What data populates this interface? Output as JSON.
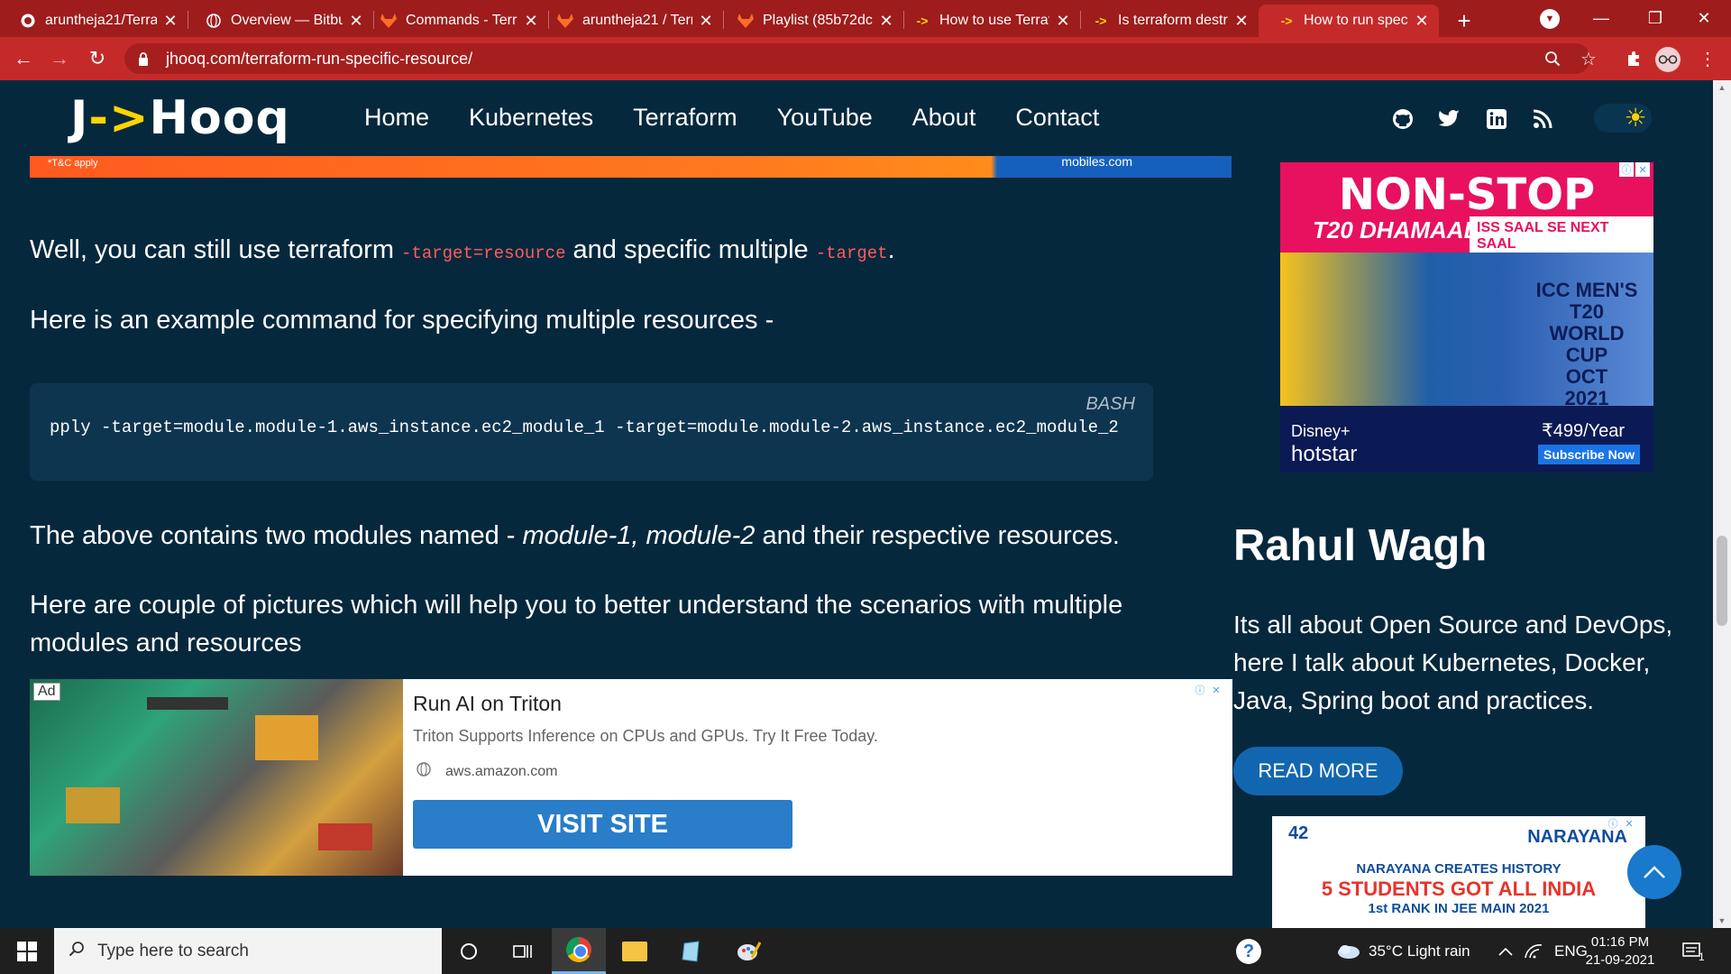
{
  "browser": {
    "tabs": [
      {
        "title": "aruntheja21/Terra",
        "favicon": "github-icon"
      },
      {
        "title": "Overview — Bitbu",
        "favicon": "globe-icon"
      },
      {
        "title": "Commands - Terra",
        "favicon": "gitlab-icon"
      },
      {
        "title": "aruntheja21 / Terr",
        "favicon": "gitlab-icon"
      },
      {
        "title": "Playlist (85b72dc",
        "favicon": "gitlab-icon"
      },
      {
        "title": "How to use Terraf",
        "favicon": "jhooq-icon"
      },
      {
        "title": "Is terraform destr",
        "favicon": "jhooq-icon"
      },
      {
        "title": "How to run specif",
        "favicon": "jhooq-icon"
      }
    ],
    "active_tab": 7,
    "tab_close_glyph": "✕",
    "url": "jhooq.com/terraform-run-specific-resource/",
    "colors": {
      "tabbar": "#9e1c1c",
      "toolbar": "#c52a2a"
    }
  },
  "site": {
    "logo": {
      "prefix": "J",
      "arrow": "->",
      "suffix": "Hooq"
    },
    "nav": [
      "Home",
      "Kubernetes",
      "Terraform",
      "YouTube",
      "About",
      "Contact"
    ],
    "social_icons": [
      "github-icon",
      "twitter-icon",
      "linkedin-icon",
      "rss-icon"
    ],
    "theme_toggle": "sun-icon"
  },
  "top_ad": {
    "tc": "*T&C apply",
    "domain": "mobiles.com"
  },
  "article": {
    "p1_before": "Well, you can still use terraform ",
    "p1_code1": "-target=resource",
    "p1_middle": " and specific multiple ",
    "p1_code2": "-target",
    "p1_after": ".",
    "p2": "Here is an example command for specifying multiple resources -",
    "code_lang": "BASH",
    "code": "pply -target=module.module-1.aws_instance.ec2_module_1 -target=module.module-2.aws_instance.ec2_module_2",
    "p3_before": "The above contains two modules named - ",
    "p3_em": "module-1, module-2",
    "p3_after": " and their respective resources.",
    "p4": "Here are couple of pictures which will help you to better understand the scenarios with multiple modules and resources"
  },
  "banner_ad": {
    "tag": "Ad",
    "title": "Run AI on Triton",
    "description": "Triton Supports Inference on CPUs and GPUs. Try It Free Today.",
    "url": "aws.amazon.com",
    "cta": "VISIT SITE"
  },
  "side_ad": {
    "headline": "NON-STOP",
    "sub": "T20 DHAMAAL.",
    "tag": "ISS SAAL SE NEXT SAAL",
    "event_l1": "ICC MEN'S T20",
    "event_l2": "WORLD CUP",
    "event_l3": "OCT",
    "event_l4": "2021",
    "brand_l1": "Disney+",
    "brand_l2": "hotstar",
    "price": "₹499/Year",
    "cta": "Subscribe Now"
  },
  "author": {
    "name": "Rahul Wagh",
    "bio": "Its all about Open Source and DevOps, here I talk about Kubernetes, Docker, Java, Spring boot and practices.",
    "read_more": "READ MORE"
  },
  "side_ad2": {
    "badge": "42",
    "brand": "NARAYANA",
    "l1": "NARAYANA CREATES HISTORY",
    "l2": "5 STUDENTS GOT ALL INDIA",
    "l3": "1st RANK IN JEE MAIN 2021"
  },
  "taskbar": {
    "search_placeholder": "Type here to search",
    "weather": "35°C  Light rain",
    "lang": "ENG",
    "time": "01:16 PM",
    "date": "21-09-2021",
    "notifications": "1"
  }
}
